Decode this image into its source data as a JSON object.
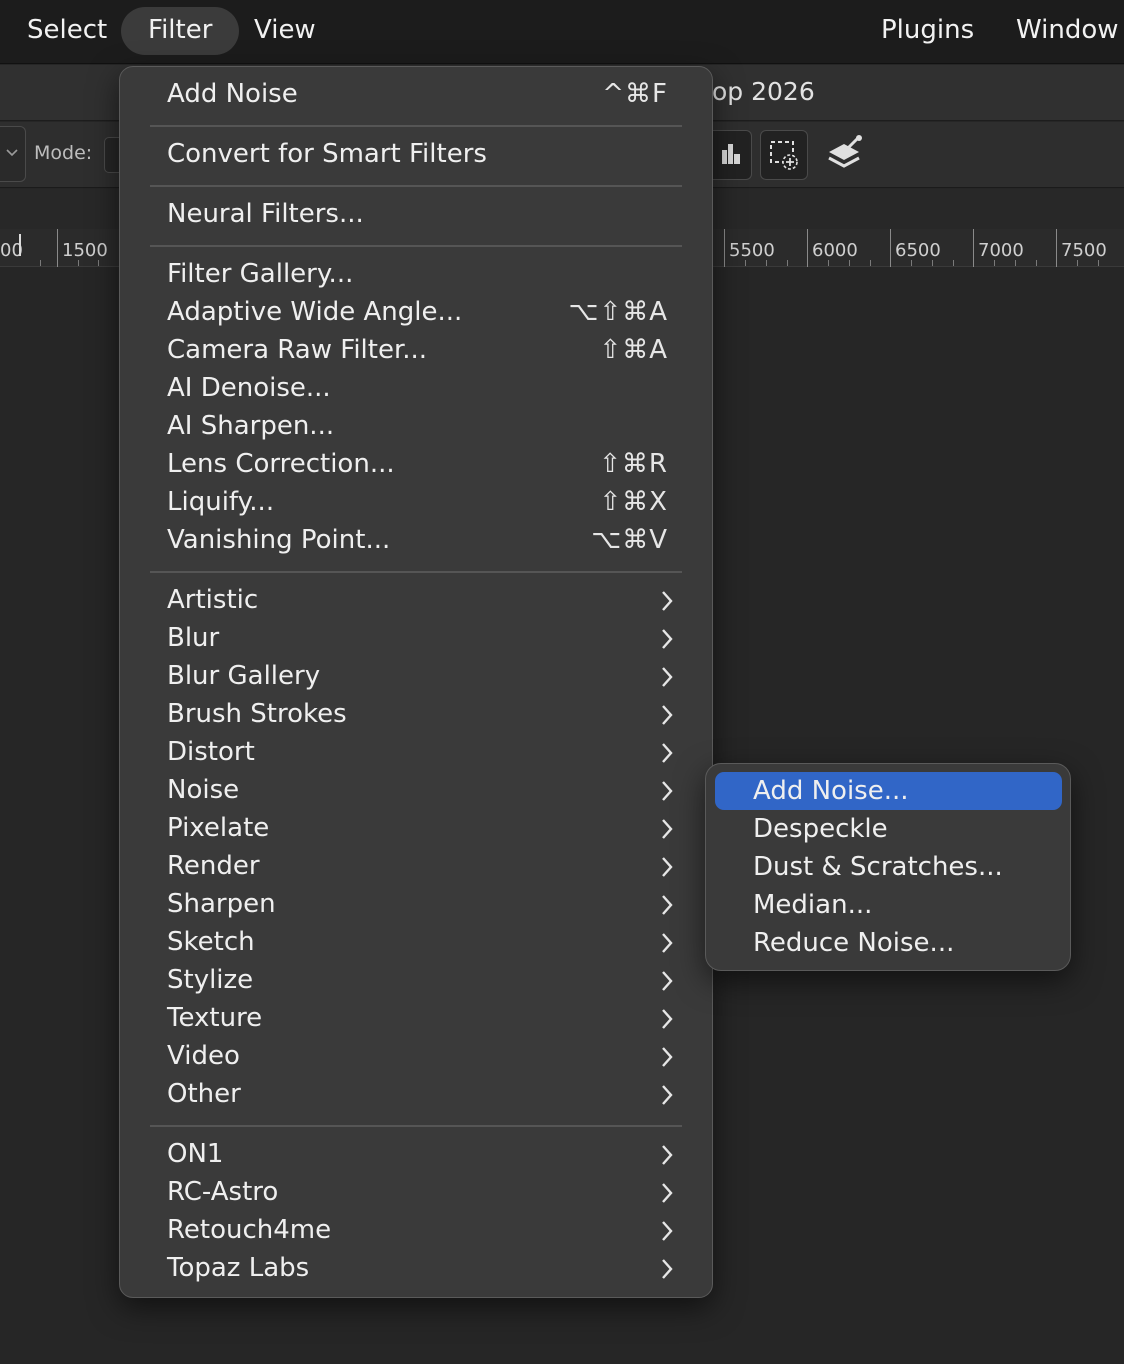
{
  "menubar": {
    "select": "Select",
    "filter": "Filter",
    "view": "View",
    "plugins": "Plugins",
    "window": "Window"
  },
  "window_title": "op 2026",
  "options_bar": {
    "mode_label": "Mode:"
  },
  "ruler": {
    "left_partial": "00",
    "labels": [
      "1500",
      "5500",
      "6000",
      "6500",
      "7000",
      "7500"
    ]
  },
  "filter_menu": {
    "last_filter": {
      "label": "Add Noise",
      "shortcut": "^⌘F"
    },
    "convert": "Convert for Smart Filters",
    "neural": "Neural Filters...",
    "filters": [
      {
        "label": "Filter Gallery...",
        "shortcut": ""
      },
      {
        "label": "Adaptive Wide Angle...",
        "shortcut": "⌥⇧⌘A"
      },
      {
        "label": "Camera Raw Filter...",
        "shortcut": "⇧⌘A"
      },
      {
        "label": "AI Denoise...",
        "shortcut": ""
      },
      {
        "label": "AI Sharpen...",
        "shortcut": ""
      },
      {
        "label": "Lens Correction...",
        "shortcut": "⇧⌘R"
      },
      {
        "label": "Liquify...",
        "shortcut": "⇧⌘X"
      },
      {
        "label": "Vanishing Point...",
        "shortcut": "⌥⌘V"
      }
    ],
    "categories": [
      "Artistic",
      "Blur",
      "Blur Gallery",
      "Brush Strokes",
      "Distort",
      "Noise",
      "Pixelate",
      "Render",
      "Sharpen",
      "Sketch",
      "Stylize",
      "Texture",
      "Video",
      "Other"
    ],
    "plugins": [
      "ON1",
      "RC-Astro",
      "Retouch4me",
      "Topaz Labs"
    ]
  },
  "noise_submenu": {
    "items": [
      "Add Noise...",
      "Despeckle",
      "Dust & Scratches...",
      "Median...",
      "Reduce Noise..."
    ],
    "highlighted": "Add Noise..."
  },
  "colors": {
    "highlight": "#3166c7",
    "menu_bg": "#3a3a3a",
    "menubar_bg": "#1c1c1c"
  }
}
